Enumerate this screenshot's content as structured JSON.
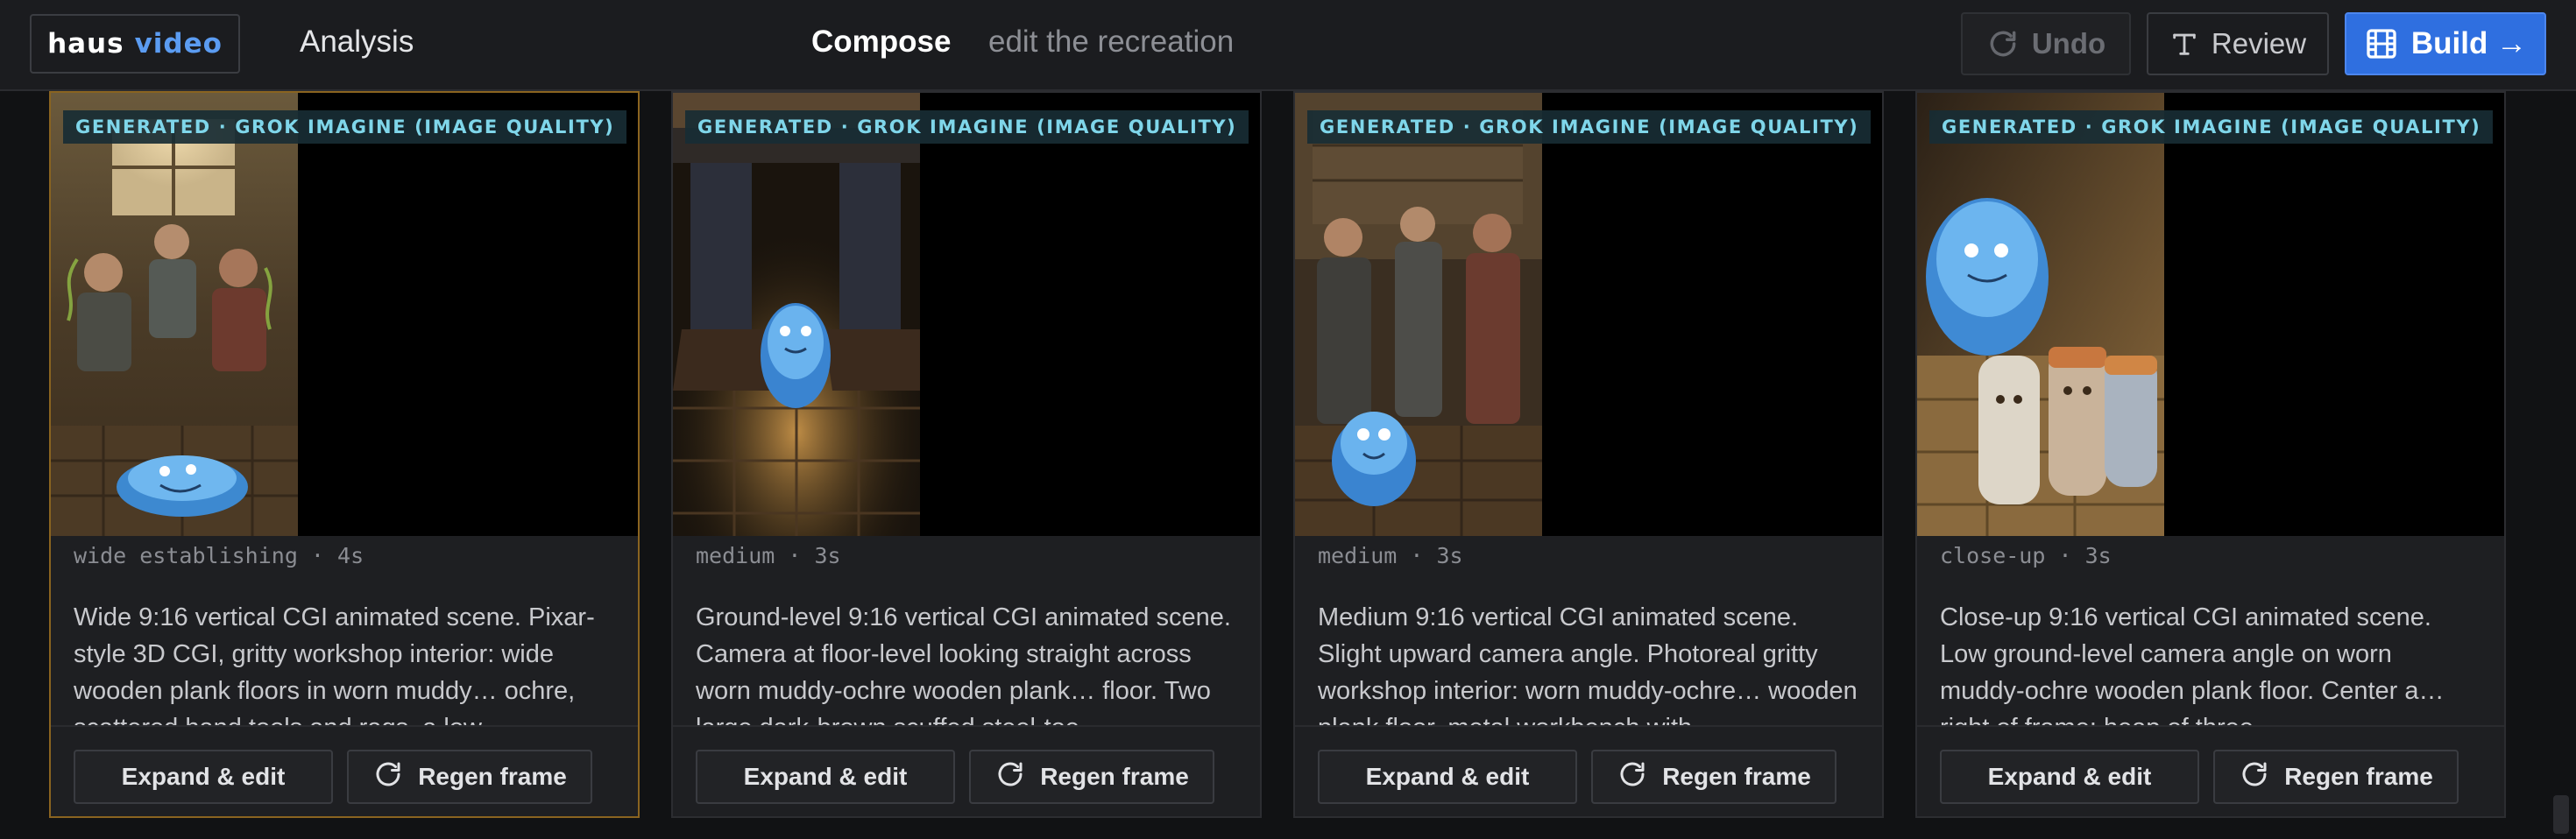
{
  "header": {
    "logo_word1": "haus",
    "logo_word2": "video",
    "nav_analysis": "Analysis",
    "nav_compose": "Compose",
    "nav_subtitle": "edit the recreation",
    "undo_label": "Undo",
    "review_label": "Review",
    "build_label": "Build →"
  },
  "colors": {
    "accent": "#2f6fe0",
    "logo_accent": "#5b9cf2",
    "badge_text": "#7fd6ea",
    "selected_border": "#8a6420"
  },
  "icons": {
    "undo": "refresh-icon",
    "review": "text-type-icon",
    "build": "film-icon",
    "regen": "refresh-icon"
  },
  "cards": [
    {
      "badge": "GENERATED · GROK IMAGINE (IMAGE QUALITY)",
      "meta": "wide establishing · 4s",
      "description": "Wide 9:16 vertical CGI animated scene. Pixar-style 3D CGI, gritty workshop interior: wide wooden plank floors in worn muddy… ochre, scattered hand tools and rags, a low",
      "expand_label": "Expand & edit",
      "regen_label": "Regen frame",
      "selected": true
    },
    {
      "badge": "GENERATED · GROK IMAGINE (IMAGE QUALITY)",
      "meta": "medium · 3s",
      "description": "Ground-level 9:16 vertical CGI animated scene. Camera at floor-level looking straight across worn muddy-ochre wooden plank… floor. Two large dark-brown scuffed steel-toe",
      "expand_label": "Expand & edit",
      "regen_label": "Regen frame",
      "selected": false
    },
    {
      "badge": "GENERATED · GROK IMAGINE (IMAGE QUALITY)",
      "meta": "medium · 3s",
      "description": "Medium 9:16 vertical CGI animated scene. Slight upward camera angle. Photoreal gritty workshop interior: worn muddy-ochre… wooden plank floor, metal workbench with",
      "expand_label": "Expand & edit",
      "regen_label": "Regen frame",
      "selected": false
    },
    {
      "badge": "GENERATED · GROK IMAGINE (IMAGE QUALITY)",
      "meta": "close-up · 3s",
      "description": "Close-up 9:16 vertical CGI animated scene. Low ground-level camera angle on worn muddy-ochre wooden plank floor. Center a… right of frame: heap of three",
      "expand_label": "Expand & edit",
      "regen_label": "Regen frame",
      "selected": false
    }
  ]
}
